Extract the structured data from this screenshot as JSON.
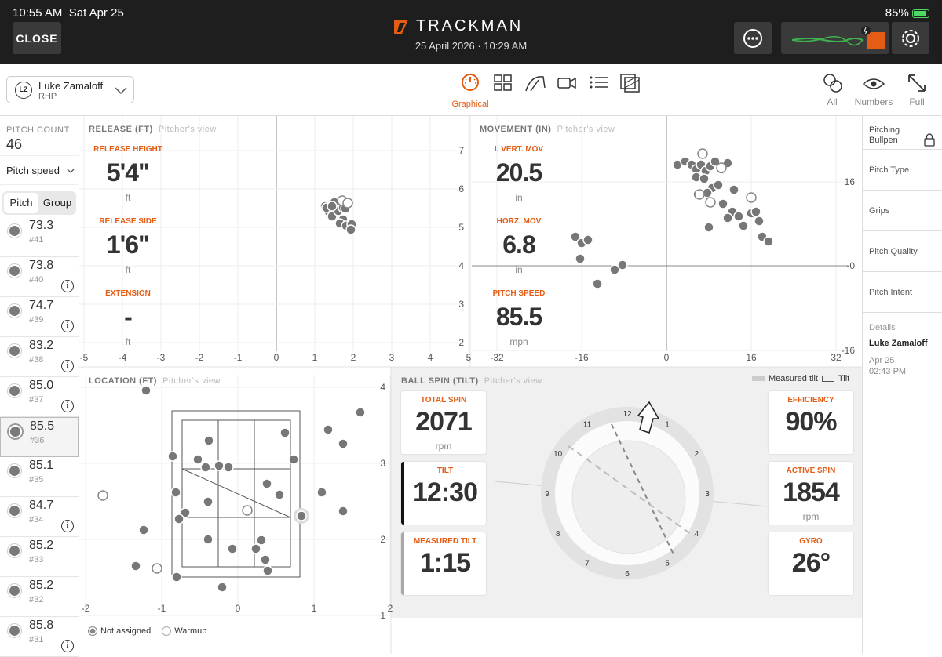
{
  "status": {
    "time": "10:55 AM",
    "date": "Sat Apr 25",
    "battery": "85%"
  },
  "header": {
    "close_label": "CLOSE",
    "brand": "TRACKMAN",
    "session_datetime": "25 April 2026 · 10:29 AM"
  },
  "player": {
    "initials": "LZ",
    "name": "Luke Zamaloff",
    "hand": "RHP"
  },
  "toolbar": {
    "active_view_label": "Graphical",
    "right": [
      {
        "label": "All"
      },
      {
        "label": "Numbers"
      },
      {
        "label": "Full"
      }
    ]
  },
  "left": {
    "pitch_count_label": "PITCH COUNT",
    "pitch_count": "46",
    "metric_select": "Pitch speed",
    "tabs": [
      "Pitch",
      "Group"
    ],
    "pitches": [
      {
        "value": "73.3",
        "num": "#41",
        "info": false
      },
      {
        "value": "73.8",
        "num": "#40",
        "info": true
      },
      {
        "value": "74.7",
        "num": "#39",
        "info": true
      },
      {
        "value": "83.2",
        "num": "#38",
        "info": true
      },
      {
        "value": "85.0",
        "num": "#37",
        "info": true
      },
      {
        "value": "85.5",
        "num": "#36",
        "info": false,
        "selected": true
      },
      {
        "value": "85.1",
        "num": "#35",
        "info": false
      },
      {
        "value": "84.7",
        "num": "#34",
        "info": true
      },
      {
        "value": "85.2",
        "num": "#33",
        "info": false
      },
      {
        "value": "85.2",
        "num": "#32",
        "info": false
      },
      {
        "value": "85.8",
        "num": "#31",
        "info": true
      }
    ]
  },
  "release": {
    "title": "RELEASE (FT)",
    "subtitle": "Pitcher's view",
    "height_label": "RELEASE HEIGHT",
    "height_value": "5'4\"",
    "height_unit": "ft",
    "side_label": "RELEASE SIDE",
    "side_value": "1'6\"",
    "side_unit": "ft",
    "ext_label": "EXTENSION",
    "ext_value": "-",
    "ext_unit": "ft",
    "xticks": [
      "-5",
      "-4",
      "-3",
      "-2",
      "-1",
      "0",
      "1",
      "2",
      "3",
      "4",
      "5"
    ],
    "yticks": [
      "7",
      "6",
      "5",
      "4",
      "3",
      "2"
    ]
  },
  "movement": {
    "title": "MOVEMENT (IN)",
    "subtitle": "Pitcher's view",
    "ivb_label": "I. VERT. MOV",
    "ivb_value": "20.5",
    "ivb_unit": "in",
    "hb_label": "HORZ. MOV",
    "hb_value": "6.8",
    "hb_unit": "in",
    "speed_label": "PITCH SPEED",
    "speed_value": "85.5",
    "speed_unit": "mph",
    "xticks": [
      "-32",
      "-16",
      "0",
      "16",
      "32"
    ],
    "yticks": [
      "16",
      "-0",
      "-16"
    ]
  },
  "location": {
    "title": "LOCATION (FT)",
    "subtitle": "Pitcher's view",
    "xticks": [
      "-2",
      "-1",
      "0",
      "1",
      "2"
    ],
    "yticks": [
      "4",
      "3",
      "2",
      "1"
    ],
    "legend": [
      "Not assigned",
      "Warmup"
    ]
  },
  "spin": {
    "title": "BALL SPIN (TILT)",
    "subtitle": "Pitcher's view",
    "legend_measured": "Measured tilt",
    "legend_tilt": "Tilt",
    "total_label": "TOTAL SPIN",
    "total_value": "2071",
    "total_unit": "rpm",
    "tilt_label": "TILT",
    "tilt_value": "12:30",
    "mtilt_label": "MEASURED TILT",
    "mtilt_value": "1:15",
    "eff_label": "EFFICIENCY",
    "eff_value": "90%",
    "active_label": "ACTIVE SPIN",
    "active_value": "1854",
    "active_unit": "rpm",
    "gyro_label": "GYRO",
    "gyro_value": "26°",
    "clock": [
      "12",
      "1",
      "2",
      "3",
      "4",
      "5",
      "6",
      "7",
      "8",
      "9",
      "10",
      "11"
    ]
  },
  "right": {
    "lock_title": "Pitching Bullpen",
    "items": [
      "Pitch Type",
      "Grips",
      "Pitch Quality",
      "Pitch Intent"
    ],
    "details_label": "Details",
    "details_name": "Luke Zamaloff",
    "details_date": "Apr 25",
    "details_time": "02:43 PM"
  },
  "colors": {
    "accent": "#e55c14",
    "topbar": "#1e1e1e",
    "dot": "#7a7a7a"
  }
}
